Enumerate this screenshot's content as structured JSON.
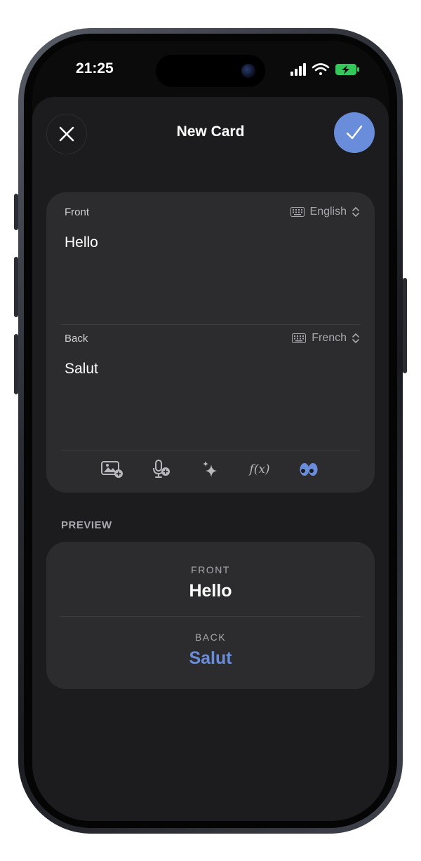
{
  "status": {
    "time": "21:25"
  },
  "header": {
    "title": "New Card"
  },
  "editor": {
    "front": {
      "label": "Front",
      "language": "English",
      "value": "Hello"
    },
    "back": {
      "label": "Back",
      "language": "French",
      "value": "Salut"
    },
    "toolbar": [
      {
        "name": "add-image-icon"
      },
      {
        "name": "add-audio-icon"
      },
      {
        "name": "sparkle-icon"
      },
      {
        "name": "formula-icon",
        "label": "f(x)"
      },
      {
        "name": "eyes-icon"
      }
    ]
  },
  "preview": {
    "heading": "PREVIEW",
    "front_label": "FRONT",
    "front_value": "Hello",
    "back_label": "BACK",
    "back_value": "Salut"
  },
  "colors": {
    "accent": "#6a8ddb",
    "background": "#0b0b0b",
    "card": "#2c2c2e",
    "sheet": "#1c1c1e",
    "battery": "#34c759"
  }
}
